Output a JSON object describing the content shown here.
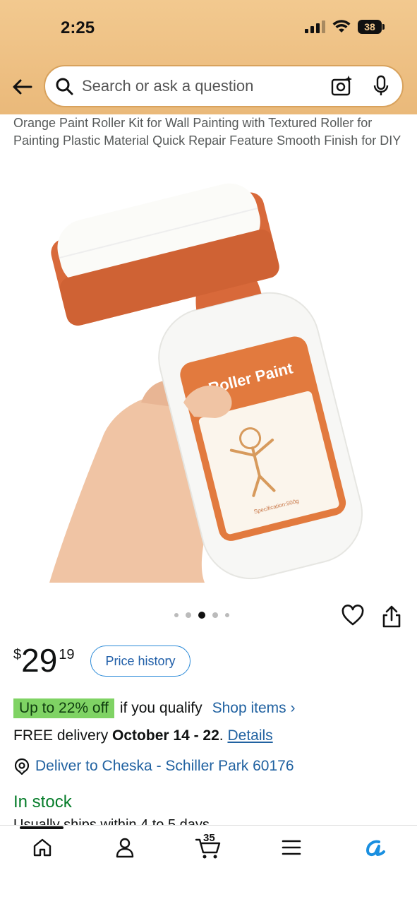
{
  "status_bar": {
    "time": "2:25",
    "battery": "38"
  },
  "search": {
    "placeholder": "Search or ask a question"
  },
  "product": {
    "title": "Orange Paint Roller Kit for Wall Painting with Textured Roller for Painting Plastic Material Quick Repair Feature Smooth Finish for DIY",
    "label_text": "Roller Paint",
    "spec_text": "Specification:500g"
  },
  "image_carousel": {
    "dot_count": 5,
    "active_index": 2
  },
  "price": {
    "currency": "$",
    "whole": "29",
    "fraction": "19",
    "history_label": "Price history"
  },
  "promo": {
    "badge": "Up to 22% off",
    "text": "if you qualify",
    "link": "Shop items ›"
  },
  "delivery": {
    "prefix": "FREE delivery",
    "dates": "October 14 - 22",
    "period": ".",
    "details": "Details"
  },
  "deliver_to": {
    "text": "Deliver to Cheska - Schiller Park 60176"
  },
  "stock": {
    "status": "In stock",
    "ships": "Usually ships within 4 to 5 days"
  },
  "nav": {
    "cart_count": "35"
  },
  "colors": {
    "header": "#f2c98f",
    "link": "#2162a1",
    "instock": "#067d2a",
    "promo": "#7fd364",
    "orange": "#d8693a"
  }
}
